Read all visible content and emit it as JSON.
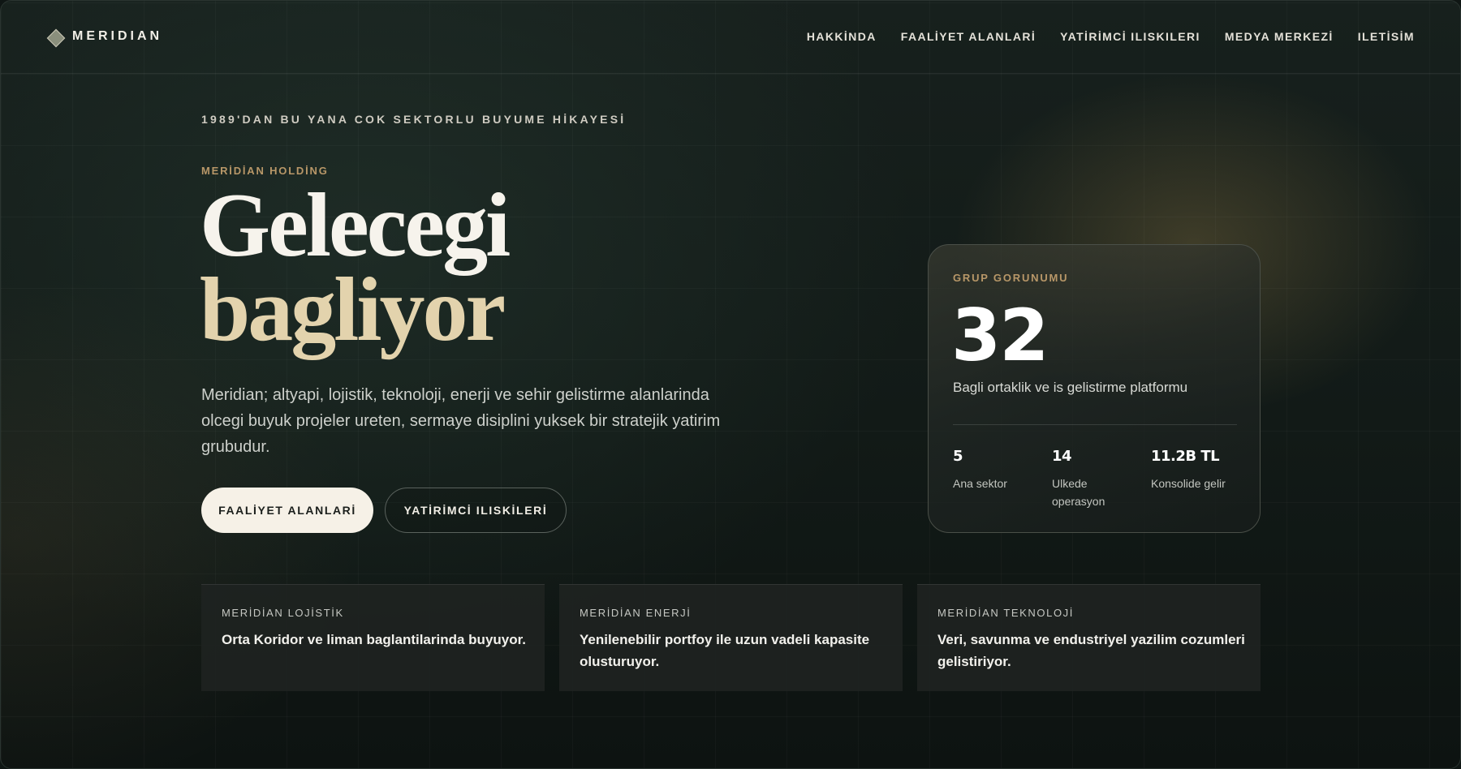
{
  "brand": {
    "name": "MERIDIAN",
    "icon": "diamond-logo-icon"
  },
  "nav": {
    "items": [
      {
        "label": "HAKKİNDA"
      },
      {
        "label": "FAALİYET ALANLARİ"
      },
      {
        "label": "YATİRİMCİ ILISKILERI"
      },
      {
        "label": "MEDYA MERKEZİ"
      },
      {
        "label": "ILETİSİM"
      }
    ]
  },
  "hero": {
    "eyebrow": "1989'DAN BU YANA COK SEKTORLU BUYUME HİKAYESİ",
    "kicker": "MERİDİAN HOLDİNG",
    "headline_line1": "Gelecegi",
    "headline_line2": "bagliyor",
    "lede": "Meridian; altyapi, lojistik, teknoloji, enerji ve sehir gelistirme alanlarinda olcegi buyuk projeler ureten, sermaye disiplini yuksek bir stratejik yatirim grubudur.",
    "primary_button": "FAALİYET ALANLARİ",
    "secondary_button": "YATİRİMCİ ILISKİLERİ"
  },
  "group_card": {
    "label": "GRUP GORUNUMU",
    "big_number": "32",
    "subtitle": "Bagli ortaklik ve is gelistirme platformu",
    "stats": [
      {
        "value": "5",
        "label": "Ana sektor"
      },
      {
        "value": "14",
        "label": "Ulkede operasyon"
      },
      {
        "value": "11.2B TL",
        "label": "Konsolide gelir"
      }
    ]
  },
  "features": [
    {
      "title": "MERİDİAN LOJİSTİK",
      "desc": "Orta Koridor ve liman baglantilarinda buyuyor."
    },
    {
      "title": "MERİDİAN ENERJİ",
      "desc": "Yenilenebilir portfoy ile uzun vadeli kapasite olusturuyor."
    },
    {
      "title": "MERİDİAN TEKNOLOJİ",
      "desc": "Veri, savunma ve endustriyel yazilim cozumleri gelistiriyor."
    }
  ],
  "colors": {
    "accent_gold": "#b89768",
    "headline_cream": "#e3d3ad",
    "background": "#121a17"
  }
}
